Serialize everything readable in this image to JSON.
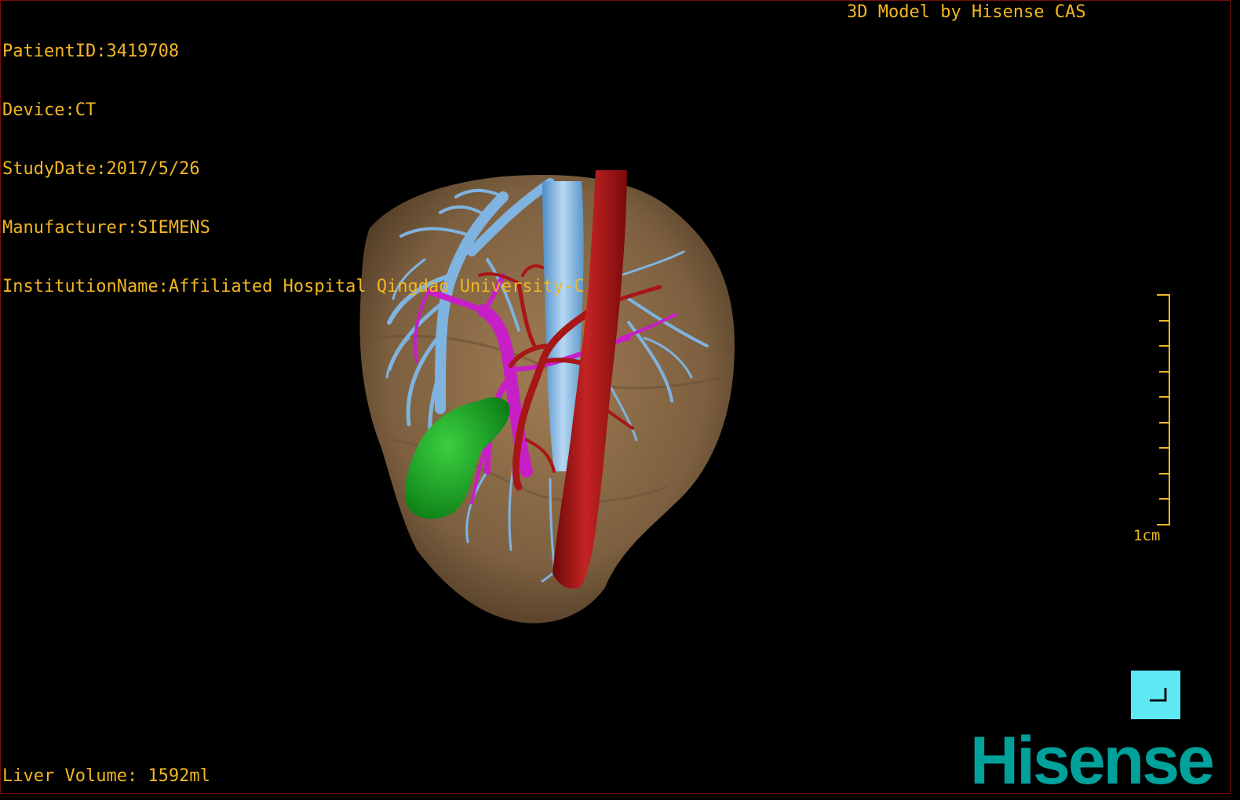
{
  "info": {
    "patient_id": "PatientID:3419708",
    "device": "Device:CT",
    "study_date": "StudyDate:2017/5/26",
    "manufacturer": "Manufacturer:SIEMENS",
    "institution": "InstitutionName:Affiliated Hospital Qingdao University-C"
  },
  "credit": "3D Model by Hisense CAS",
  "scale_label": "1cm",
  "liver_volume": "Liver Volume: 1592ml",
  "brand": "Hisense",
  "colors": {
    "text": "#f2b623",
    "liver": "#8a6a44",
    "portal_vein": "#7fb3e0",
    "artery": "#a81616",
    "hepatic_vessel": "#c81ec8",
    "gallbladder": "#10a020",
    "brand": "#00a19a",
    "corner_button": "#5de8f3"
  },
  "icons": [
    "corner-frame-icon",
    "scale-bar-icon"
  ]
}
